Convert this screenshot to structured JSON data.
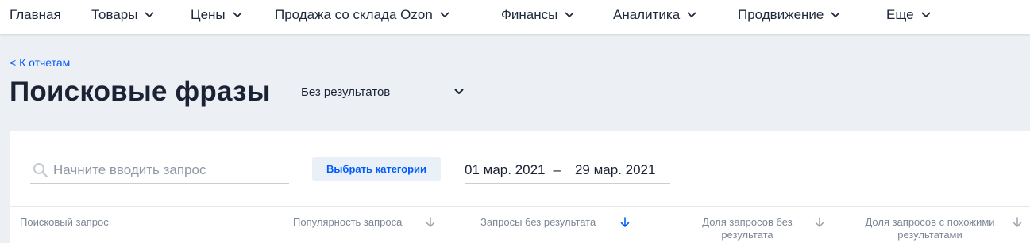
{
  "nav": {
    "items": [
      {
        "label": "Главная",
        "has_dropdown": false
      },
      {
        "label": "Товары",
        "has_dropdown": true
      },
      {
        "label": "Цены",
        "has_dropdown": true
      },
      {
        "label": "Продажа со склада Ozon",
        "has_dropdown": true
      },
      {
        "label": "Финансы",
        "has_dropdown": true
      },
      {
        "label": "Аналитика",
        "has_dropdown": true
      },
      {
        "label": "Продвижение",
        "has_dropdown": true
      },
      {
        "label": "Еще",
        "has_dropdown": true
      }
    ]
  },
  "back_link": "< К отчетам",
  "page": {
    "title": "Поисковые фразы",
    "mode_select": "Без результатов"
  },
  "filters": {
    "search_placeholder": "Начните вводить запрос",
    "category_button": "Выбрать категории",
    "date_from": "01 мар. 2021",
    "date_separator": "–",
    "date_to": "29 мар. 2021"
  },
  "table": {
    "columns": [
      {
        "label": "Поисковый запрос",
        "sortable": false
      },
      {
        "label": "Популярность запроса",
        "sortable": true,
        "active": false
      },
      {
        "label": "Запросы без результата",
        "sortable": true,
        "active": true
      },
      {
        "label": "Доля запросов без результата",
        "sortable": true,
        "active": false
      },
      {
        "label": "Доля запросов с похожими результатами",
        "sortable": true,
        "active": false
      }
    ]
  },
  "colors": {
    "accent": "#005bff",
    "text": "#1a2233",
    "muted": "#7b8694",
    "background": "#eceff4"
  }
}
